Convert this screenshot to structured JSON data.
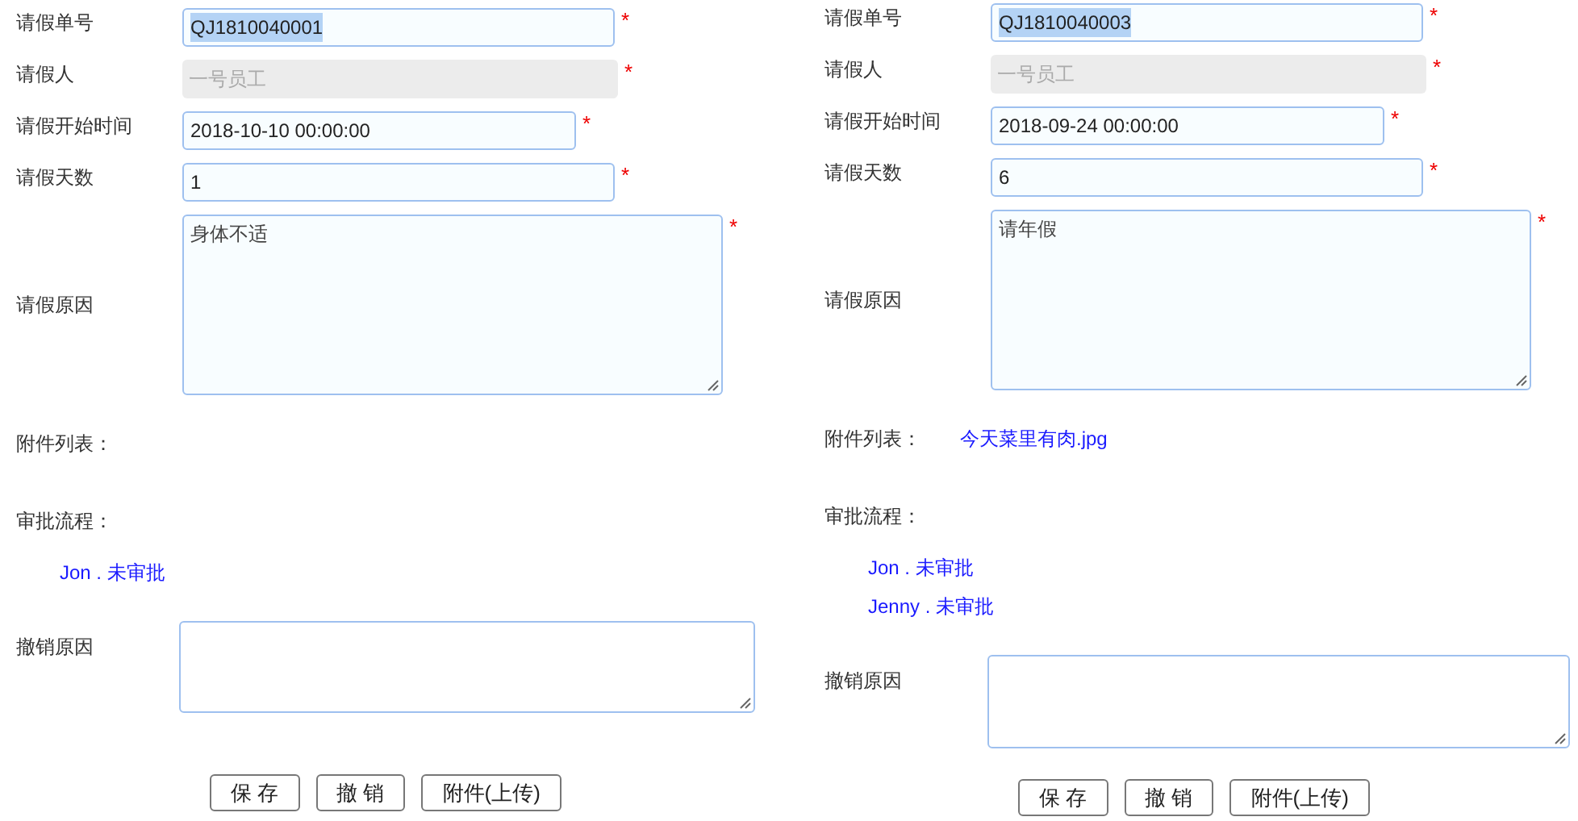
{
  "forms": [
    {
      "fields": [
        {
          "label": "请假单号",
          "kind": "text",
          "value": "QJ1810040001",
          "highlighted": true,
          "required_mark": "*"
        },
        {
          "label": "请假人",
          "kind": "readonly",
          "value": "一号员工",
          "highlighted": false,
          "required_mark": "*"
        },
        {
          "label": "请假开始时间",
          "kind": "date",
          "value": "2018-10-10 00:00:00",
          "highlighted": false,
          "required_mark": "*"
        },
        {
          "label": "请假天数",
          "kind": "text",
          "value": "1",
          "highlighted": false,
          "required_mark": "*"
        },
        {
          "label": "请假原因",
          "kind": "textarea",
          "value": "身体不适",
          "highlighted": false,
          "required_mark": "*"
        }
      ],
      "attachments_label": "附件列表：",
      "approval_label": "审批流程：",
      "approvals": [
        "Jon . 未审批"
      ],
      "cancel_label": "撤销原因",
      "buttons": [
        "保 存",
        "撤 销",
        "附件(上传)"
      ]
    },
    {
      "fields": [
        {
          "label": "请假单号",
          "kind": "text",
          "value": "QJ1810040003",
          "highlighted": true,
          "required_mark": "*"
        },
        {
          "label": "请假人",
          "kind": "readonly",
          "value": "一号员工",
          "highlighted": false,
          "required_mark": "*"
        },
        {
          "label": "请假开始时间",
          "kind": "date",
          "value": "2018-09-24 00:00:00",
          "highlighted": false,
          "required_mark": "*"
        },
        {
          "label": "请假天数",
          "kind": "text",
          "value": "6",
          "highlighted": false,
          "required_mark": "*"
        },
        {
          "label": "请假原因",
          "kind": "textarea",
          "value": "请年假",
          "highlighted": false,
          "required_mark": "*"
        }
      ],
      "attachments_label": "附件列表：",
      "attachments": [
        "今天菜里有肉.jpg"
      ],
      "approval_label": "审批流程：",
      "approvals": [
        "Jon . 未审批",
        "Jenny . 未审批"
      ],
      "cancel_label": "撤销原因",
      "buttons": [
        "保 存",
        "撤 销",
        "附件(上传)"
      ]
    }
  ]
}
